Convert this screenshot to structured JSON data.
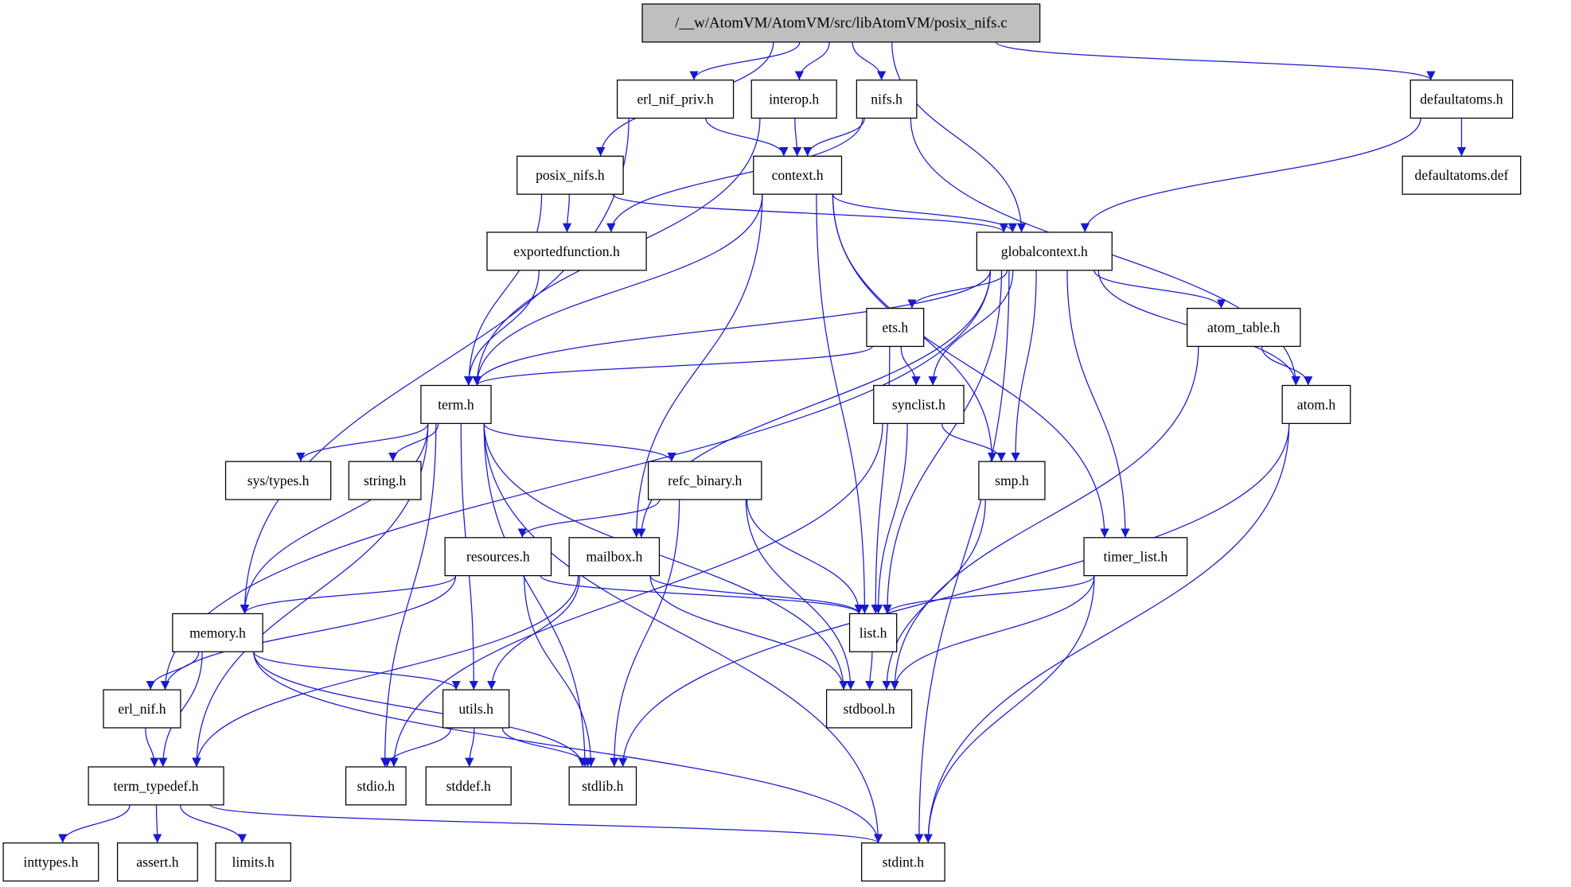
{
  "colors": {
    "edge": "#1919d0",
    "root_fill": "#bfbfbf",
    "node_fill": "#ffffff"
  },
  "nodes": [
    {
      "id": "main",
      "label": "/__w/AtomVM/AtomVM/src/libAtomVM/posix_nifs.c",
      "root": true
    },
    {
      "id": "erl_nif_priv",
      "label": "erl_nif_priv.h"
    },
    {
      "id": "interop",
      "label": "interop.h"
    },
    {
      "id": "nifs",
      "label": "nifs.h"
    },
    {
      "id": "defaultatoms",
      "label": "defaultatoms.h"
    },
    {
      "id": "posix_nifs",
      "label": "posix_nifs.h"
    },
    {
      "id": "context",
      "label": "context.h"
    },
    {
      "id": "defaultatoms_def",
      "label": "defaultatoms.def"
    },
    {
      "id": "exportedfunction",
      "label": "exportedfunction.h"
    },
    {
      "id": "globalcontext",
      "label": "globalcontext.h"
    },
    {
      "id": "ets",
      "label": "ets.h"
    },
    {
      "id": "atom_table",
      "label": "atom_table.h"
    },
    {
      "id": "term",
      "label": "term.h"
    },
    {
      "id": "synclist",
      "label": "synclist.h"
    },
    {
      "id": "atom",
      "label": "atom.h"
    },
    {
      "id": "sys_types",
      "label": "sys/types.h"
    },
    {
      "id": "string",
      "label": "string.h"
    },
    {
      "id": "refc_binary",
      "label": "refc_binary.h"
    },
    {
      "id": "smp",
      "label": "smp.h"
    },
    {
      "id": "resources",
      "label": "resources.h"
    },
    {
      "id": "mailbox",
      "label": "mailbox.h"
    },
    {
      "id": "timer_list",
      "label": "timer_list.h"
    },
    {
      "id": "memory",
      "label": "memory.h"
    },
    {
      "id": "list",
      "label": "list.h"
    },
    {
      "id": "erl_nif",
      "label": "erl_nif.h"
    },
    {
      "id": "utils",
      "label": "utils.h"
    },
    {
      "id": "stdbool",
      "label": "stdbool.h"
    },
    {
      "id": "term_typedef",
      "label": "term_typedef.h"
    },
    {
      "id": "stdio",
      "label": "stdio.h"
    },
    {
      "id": "stddef",
      "label": "stddef.h"
    },
    {
      "id": "stdlib",
      "label": "stdlib.h"
    },
    {
      "id": "inttypes",
      "label": "inttypes.h"
    },
    {
      "id": "assert",
      "label": "assert.h"
    },
    {
      "id": "limits",
      "label": "limits.h"
    },
    {
      "id": "stdint",
      "label": "stdint.h"
    }
  ],
  "edges": [
    [
      "main",
      "posix_nifs"
    ],
    [
      "main",
      "erl_nif_priv"
    ],
    [
      "main",
      "interop"
    ],
    [
      "main",
      "nifs"
    ],
    [
      "main",
      "globalcontext"
    ],
    [
      "main",
      "defaultatoms"
    ],
    [
      "erl_nif_priv",
      "memory"
    ],
    [
      "erl_nif_priv",
      "context"
    ],
    [
      "interop",
      "term"
    ],
    [
      "interop",
      "context"
    ],
    [
      "nifs",
      "exportedfunction"
    ],
    [
      "nifs",
      "context"
    ],
    [
      "nifs",
      "atom"
    ],
    [
      "defaultatoms",
      "defaultatoms_def"
    ],
    [
      "defaultatoms",
      "globalcontext"
    ],
    [
      "posix_nifs",
      "exportedfunction"
    ],
    [
      "posix_nifs",
      "term"
    ],
    [
      "posix_nifs",
      "globalcontext"
    ],
    [
      "context",
      "term"
    ],
    [
      "context",
      "mailbox"
    ],
    [
      "context",
      "list"
    ],
    [
      "context",
      "smp"
    ],
    [
      "context",
      "globalcontext"
    ],
    [
      "context",
      "timer_list"
    ],
    [
      "exportedfunction",
      "term"
    ],
    [
      "globalcontext",
      "erl_nif"
    ],
    [
      "globalcontext",
      "term"
    ],
    [
      "globalcontext",
      "mailbox"
    ],
    [
      "globalcontext",
      "ets"
    ],
    [
      "globalcontext",
      "synclist"
    ],
    [
      "globalcontext",
      "smp"
    ],
    [
      "globalcontext",
      "list"
    ],
    [
      "globalcontext",
      "timer_list"
    ],
    [
      "globalcontext",
      "atom_table"
    ],
    [
      "globalcontext",
      "atom"
    ],
    [
      "globalcontext",
      "stdint"
    ],
    [
      "ets",
      "term"
    ],
    [
      "ets",
      "synclist"
    ],
    [
      "ets",
      "list"
    ],
    [
      "atom_table",
      "atom"
    ],
    [
      "atom_table",
      "stdbool"
    ],
    [
      "synclist",
      "stdio"
    ],
    [
      "synclist",
      "smp"
    ],
    [
      "synclist",
      "list"
    ],
    [
      "atom",
      "stdlib"
    ],
    [
      "atom",
      "stdint"
    ],
    [
      "term",
      "sys_types"
    ],
    [
      "term",
      "string"
    ],
    [
      "term",
      "refc_binary"
    ],
    [
      "term",
      "memory"
    ],
    [
      "term",
      "utils"
    ],
    [
      "term",
      "stdio"
    ],
    [
      "term",
      "stdint"
    ],
    [
      "term",
      "stdbool"
    ],
    [
      "term",
      "stdlib"
    ],
    [
      "term",
      "term_typedef"
    ],
    [
      "refc_binary",
      "resources"
    ],
    [
      "refc_binary",
      "list"
    ],
    [
      "refc_binary",
      "stdbool"
    ],
    [
      "refc_binary",
      "stdlib"
    ],
    [
      "smp",
      "stdbool"
    ],
    [
      "resources",
      "erl_nif"
    ],
    [
      "resources",
      "memory"
    ],
    [
      "resources",
      "list"
    ],
    [
      "resources",
      "stdlib"
    ],
    [
      "mailbox",
      "term_typedef"
    ],
    [
      "mailbox",
      "utils"
    ],
    [
      "mailbox",
      "list"
    ],
    [
      "mailbox",
      "stdbool"
    ],
    [
      "timer_list",
      "list"
    ],
    [
      "timer_list",
      "stdbool"
    ],
    [
      "timer_list",
      "stdint"
    ],
    [
      "memory",
      "erl_nif"
    ],
    [
      "memory",
      "term_typedef"
    ],
    [
      "memory",
      "utils"
    ],
    [
      "memory",
      "stdlib"
    ],
    [
      "memory",
      "stdint"
    ],
    [
      "list",
      "stdbool"
    ],
    [
      "erl_nif",
      "term_typedef"
    ],
    [
      "utils",
      "stdio"
    ],
    [
      "utils",
      "stddef"
    ],
    [
      "utils",
      "stdlib"
    ],
    [
      "term_typedef",
      "inttypes"
    ],
    [
      "term_typedef",
      "assert"
    ],
    [
      "term_typedef",
      "limits"
    ],
    [
      "term_typedef",
      "stdint"
    ]
  ]
}
